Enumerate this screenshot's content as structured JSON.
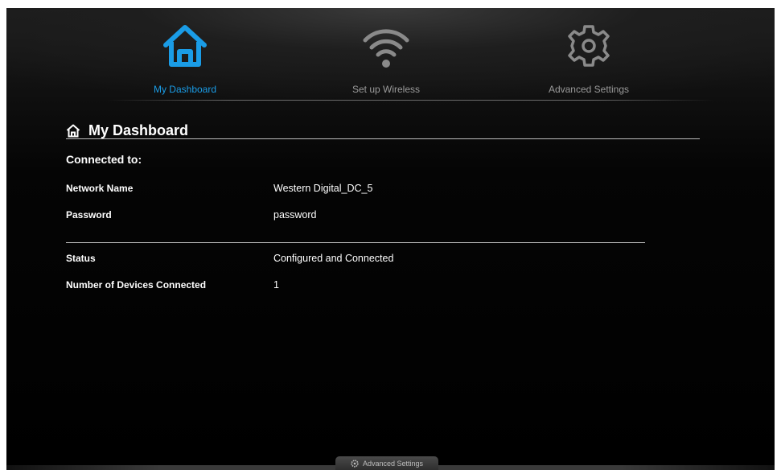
{
  "nav": {
    "items": [
      {
        "label": "My Dashboard",
        "icon": "home-icon",
        "active": true
      },
      {
        "label": "Set up Wireless",
        "icon": "wifi-icon",
        "active": false
      },
      {
        "label": "Advanced Settings",
        "icon": "gear-icon",
        "active": false
      }
    ]
  },
  "page": {
    "title": "My Dashboard",
    "title_icon": "home-outline-icon"
  },
  "connection": {
    "heading": "Connected to:",
    "network_name_label": "Network Name",
    "network_name_value": "Western Digital_DC_5",
    "password_label": "Password",
    "password_value": "password"
  },
  "status": {
    "status_label": "Status",
    "status_value": "Configured and Connected",
    "devices_label": "Number of Devices Connected",
    "devices_value": "1"
  },
  "footer": {
    "tab_label": "Advanced Settings",
    "tab_icon": "gear-icon"
  },
  "colors": {
    "accent": "#1a9ce6",
    "background": "#000000",
    "inactive_icon": "#8a8a8a"
  }
}
